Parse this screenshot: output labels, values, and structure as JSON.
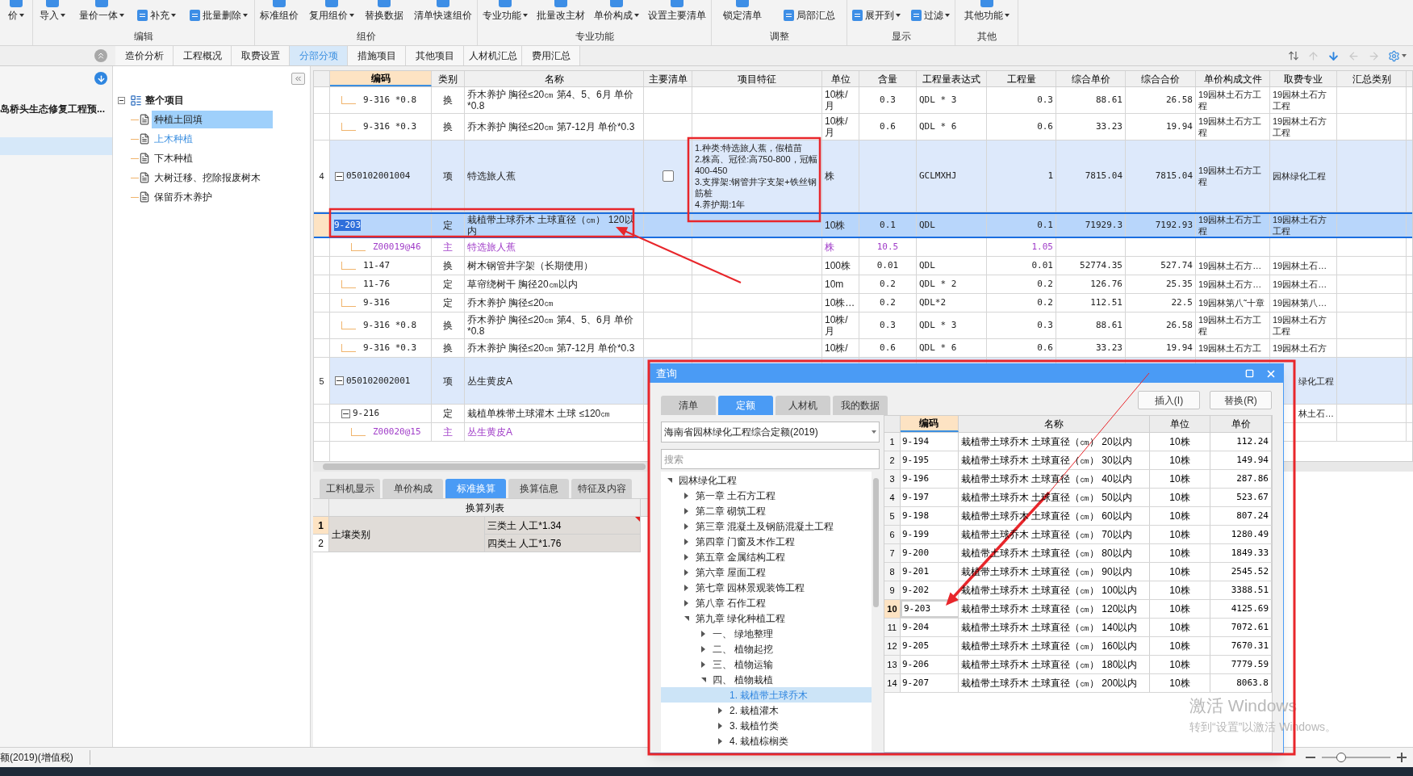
{
  "toolbar": {
    "groups": [
      {
        "tools": [
          {
            "label": "价",
            "menu": true
          }
        ]
      },
      {
        "label": "编辑",
        "tools": [
          {
            "label": "导入",
            "menu": true
          },
          {
            "label": "量价一体",
            "menu": true
          },
          {
            "label": "补充",
            "menu": true
          },
          {
            "label": "批量删除",
            "menu": true
          }
        ]
      },
      {
        "label": "组价",
        "tools": [
          {
            "label": "标准组价",
            "menu": false
          },
          {
            "label": "复用组价",
            "menu": true
          },
          {
            "label": "替换数据",
            "menu": false
          },
          {
            "label": "清单快速组价",
            "menu": false
          }
        ]
      },
      {
        "label": "专业功能",
        "tools": [
          {
            "label": "专业功能",
            "menu": true
          },
          {
            "label": "批量改主材",
            "menu": false
          },
          {
            "label": "单价构成",
            "menu": true
          },
          {
            "label": "设置主要清单",
            "menu": false
          }
        ]
      },
      {
        "label": "调整",
        "tools": [
          {
            "label": "锁定清单",
            "menu": false
          },
          {
            "label": "局部汇总",
            "menu": false
          }
        ]
      },
      {
        "label": "显示",
        "tools": [
          {
            "label": "展开到",
            "menu": true
          },
          {
            "label": "过滤",
            "menu": true
          }
        ]
      },
      {
        "label": "其他",
        "tools": [
          {
            "label": "其他功能",
            "menu": true
          }
        ]
      }
    ]
  },
  "tabs": [
    {
      "label": "造价分析",
      "selected": false
    },
    {
      "label": "工程概况",
      "selected": false
    },
    {
      "label": "取费设置",
      "selected": false
    },
    {
      "label": "分部分项",
      "selected": true
    },
    {
      "label": "措施项目",
      "selected": false
    },
    {
      "label": "其他项目",
      "selected": false
    },
    {
      "label": "人材机汇总",
      "selected": false
    },
    {
      "label": "费用汇总",
      "selected": false
    }
  ],
  "project_panel": {
    "title": "岛桥头生态修复工程预..."
  },
  "section_tree": {
    "label": "整个项目",
    "expanded": true,
    "children": [
      {
        "label": "种植土回填",
        "selected": true,
        "hovered": false
      },
      {
        "label": "上木种植",
        "selected": false,
        "hovered": true
      },
      {
        "label": "下木种植",
        "selected": false,
        "hovered": false
      },
      {
        "label": "大树迁移、挖除报废树木",
        "selected": false,
        "hovered": false
      },
      {
        "label": "保留乔木养护",
        "selected": false,
        "hovered": false
      }
    ]
  },
  "grid": {
    "columns": [
      {
        "label": "编码",
        "selected": true
      },
      {
        "label": "类别",
        "selected": false
      },
      {
        "label": "名称",
        "selected": false
      },
      {
        "label": "主要清单",
        "selected": false
      },
      {
        "label": "项目特征",
        "selected": false
      },
      {
        "label": "单位",
        "selected": false
      },
      {
        "label": "含量",
        "selected": false
      },
      {
        "label": "工程量表达式",
        "selected": false
      },
      {
        "label": "工程量",
        "selected": false
      },
      {
        "label": "综合单价",
        "selected": false
      },
      {
        "label": "综合合价",
        "selected": false
      },
      {
        "label": "单价构成文件",
        "selected": false
      },
      {
        "label": "取费专业",
        "selected": false
      },
      {
        "label": "汇总类别",
        "selected": false
      }
    ],
    "rows": [
      {
        "kind": "quota",
        "selected": false,
        "code": "9-316 *0.8",
        "type": "换",
        "name": "乔木养护 胸径≤20㎝ 第4、5、6月 单价*0.8",
        "unit": "10株/月",
        "ratio": "0.3",
        "expr": "QDL * 3",
        "qty": "0.3",
        "unit_price": "88.61",
        "total": "26.58",
        "price_file": "19园林土石方工程",
        "fee": "19园林土石方工程"
      },
      {
        "kind": "quota",
        "selected": false,
        "code": "9-316 *0.3",
        "type": "换",
        "name": "乔木养护 胸径≤20㎝ 第7-12月 单价*0.3",
        "unit": "10株/月",
        "ratio": "0.6",
        "expr": "QDL * 6",
        "qty": "0.6",
        "unit_price": "33.23",
        "total": "19.94",
        "price_file": "19园林土石方工程",
        "fee": "19园林土石方工程"
      },
      {
        "kind": "item",
        "selected": false,
        "num": "4",
        "code": "050102001004",
        "expanded": true,
        "type": "项",
        "name": "特选旅人蕉",
        "main_list": false,
        "feature": "1.种类:特选旅人蕉，假植苗\n2.株高、冠径:高750-800，冠幅400-450\n3.支撑架:钢管井字支架+铁丝钢筋桩\n4.养护期:1年",
        "unit": "株",
        "expr": "GCLMXHJ",
        "qty": "1",
        "unit_price": "7815.04",
        "total": "7815.04",
        "price_file": "19园林土石方工程",
        "fee": "园林绿化工程"
      },
      {
        "kind": "quota",
        "selected": true,
        "code": "9-203",
        "type": "定",
        "name": "栽植带土球乔木 土球直径（㎝） 120以内",
        "unit": "10株",
        "ratio": "0.1",
        "expr": "QDL",
        "qty": "0.1",
        "unit_price": "71929.3",
        "total": "7192.93",
        "price_file": "19园林土石方工程",
        "fee": "19园林土石方工程"
      },
      {
        "kind": "material",
        "selected": false,
        "code": "Z00019@46",
        "type": "主",
        "name": "特选旅人蕉",
        "unit": "株",
        "ratio": "10.5",
        "qty": "1.05"
      },
      {
        "kind": "quota",
        "selected": false,
        "code": "11-47",
        "type": "换",
        "name": "树木钢管井字架（长期使用）",
        "unit": "100株",
        "ratio": "0.01",
        "expr": "QDL",
        "qty": "0.01",
        "unit_price": "52774.35",
        "total": "527.74",
        "price_file": "19园林土石方…",
        "fee": "19园林土石…"
      },
      {
        "kind": "quota",
        "selected": false,
        "code": "11-76",
        "type": "定",
        "name": "草帘绕树干 胸径20㎝以内",
        "unit": "10m",
        "ratio": "0.2",
        "expr": "QDL * 2",
        "qty": "0.2",
        "unit_price": "126.76",
        "total": "25.35",
        "price_file": "19园林土石方…",
        "fee": "19园林土石…"
      },
      {
        "kind": "quota",
        "selected": false,
        "code": "9-316",
        "type": "定",
        "name": "乔木养护 胸径≤20㎝",
        "unit": "10株…",
        "ratio": "0.2",
        "expr": "QDL*2",
        "qty": "0.2",
        "unit_price": "112.51",
        "total": "22.5",
        "price_file": "19园林第八˜十章",
        "fee": "19园林第八…"
      },
      {
        "kind": "quota",
        "selected": false,
        "code": "9-316 *0.8",
        "type": "换",
        "name": "乔木养护 胸径≤20㎝ 第4、5、6月 单价*0.8",
        "unit": "10株/月",
        "ratio": "0.3",
        "expr": "QDL * 3",
        "qty": "0.3",
        "unit_price": "88.61",
        "total": "26.58",
        "price_file": "19园林土石方工程",
        "fee": "19园林土石方工程"
      },
      {
        "kind": "quota",
        "selected": false,
        "code": "9-316 *0.3",
        "type": "换",
        "name": "乔木养护 胸径≤20㎝ 第7-12月 单价*0.3",
        "unit": "10株/",
        "ratio": "0.6",
        "expr": "QDL * 6",
        "qty": "0.6",
        "unit_price": "33.23",
        "total": "19.94",
        "price_file": "19园林土石方工",
        "fee": "19园林土石方"
      },
      {
        "kind": "item",
        "selected": false,
        "num": "5",
        "code": "050102002001",
        "expanded": true,
        "type": "项",
        "name": "丛生黄皮A",
        "fee": "绿化工程"
      },
      {
        "kind": "quota",
        "selected": false,
        "code": "9-216",
        "expanded": true,
        "type": "定",
        "name": "栽植单株带土球灌木 土球 ≤120㎝",
        "fee": "林土石…"
      },
      {
        "kind": "material",
        "selected": false,
        "code": "Z00020@15",
        "type": "主",
        "name": "丛生黄皮A"
      }
    ]
  },
  "bottom_tabs": [
    {
      "label": "工料机显示",
      "selected": false
    },
    {
      "label": "单价构成",
      "selected": false
    },
    {
      "label": "标准换算",
      "selected": true
    },
    {
      "label": "换算信息",
      "selected": false
    },
    {
      "label": "特征及内容",
      "selected": false
    }
  ],
  "conversion_table": {
    "header": "换算列表",
    "groups": [
      {
        "label": "土壤类别",
        "rows": [
          {
            "num": "1",
            "value": "三类土 人工*1.34",
            "selected": true
          },
          {
            "num": "2",
            "value": "四类土 人工*1.76",
            "selected": false
          }
        ]
      }
    ]
  },
  "status_bar": {
    "text": "额(2019)(增值税)",
    "zoom": {
      "level": 0.25
    }
  },
  "query_dialog": {
    "title": "查询",
    "tabs": [
      {
        "label": "清单",
        "selected": false
      },
      {
        "label": "定额",
        "selected": true
      },
      {
        "label": "人材机",
        "selected": false
      },
      {
        "label": "我的数据",
        "selected": false
      }
    ],
    "buttons": [
      "插入(I)",
      "替换(R)"
    ],
    "library": "海南省园林绿化工程综合定额(2019)",
    "search": {
      "placeholder": "搜索"
    },
    "tree": [
      {
        "label": "园林绿化工程",
        "expanded": true,
        "selected": false,
        "children": [
          {
            "label": "第一章 土石方工程",
            "expanded": false,
            "selected": false
          },
          {
            "label": "第二章 砌筑工程",
            "expanded": false,
            "selected": false
          },
          {
            "label": "第三章 混凝土及钢筋混凝土工程",
            "expanded": false,
            "selected": false
          },
          {
            "label": "第四章 门窗及木作工程",
            "expanded": false,
            "selected": false
          },
          {
            "label": "第五章 金属结构工程",
            "expanded": false,
            "selected": false
          },
          {
            "label": "第六章 屋面工程",
            "expanded": false,
            "selected": false
          },
          {
            "label": "第七章 园林景观装饰工程",
            "expanded": false,
            "selected": false
          },
          {
            "label": "第八章 石作工程",
            "expanded": false,
            "selected": false
          },
          {
            "label": "第九章 绿化种植工程",
            "expanded": true,
            "selected": false,
            "children": [
              {
                "label": "一、 绿地整理",
                "expanded": false,
                "selected": false
              },
              {
                "label": "二、 植物起挖",
                "expanded": false,
                "selected": false
              },
              {
                "label": "三、 植物运输",
                "expanded": false,
                "selected": false
              },
              {
                "label": "四、 植物栽植",
                "expanded": true,
                "selected": false,
                "children": [
                  {
                    "label": "1. 栽植带土球乔木",
                    "selected": true
                  },
                  {
                    "label": "2. 栽植灌木",
                    "expanded": false,
                    "selected": false
                  },
                  {
                    "label": "3. 栽植竹类",
                    "expanded": false,
                    "selected": false
                  },
                  {
                    "label": "4. 栽植棕榈类",
                    "expanded": false,
                    "selected": false
                  }
                ]
              }
            ]
          }
        ]
      }
    ],
    "table": {
      "columns": [
        {
          "label": "编码",
          "selected": true
        },
        {
          "label": "名称",
          "selected": false
        },
        {
          "label": "单位",
          "selected": false
        },
        {
          "label": "单价",
          "selected": false
        }
      ],
      "rows": [
        {
          "num": "1",
          "code": "9-194",
          "name": "栽植带土球乔木 土球直径（㎝） 20以内",
          "unit": "10株",
          "price": "112.24",
          "selected": false
        },
        {
          "num": "2",
          "code": "9-195",
          "name": "栽植带土球乔木 土球直径（㎝） 30以内",
          "unit": "10株",
          "price": "149.94",
          "selected": false
        },
        {
          "num": "3",
          "code": "9-196",
          "name": "栽植带土球乔木 土球直径（㎝） 40以内",
          "unit": "10株",
          "price": "287.86",
          "selected": false
        },
        {
          "num": "4",
          "code": "9-197",
          "name": "栽植带土球乔木 土球直径（㎝） 50以内",
          "unit": "10株",
          "price": "523.67",
          "selected": false
        },
        {
          "num": "5",
          "code": "9-198",
          "name": "栽植带土球乔木 土球直径（㎝） 60以内",
          "unit": "10株",
          "price": "807.24",
          "selected": false
        },
        {
          "num": "6",
          "code": "9-199",
          "name": "栽植带土球乔木 土球直径（㎝） 70以内",
          "unit": "10株",
          "price": "1280.49",
          "selected": false
        },
        {
          "num": "7",
          "code": "9-200",
          "name": "栽植带土球乔木 土球直径（㎝） 80以内",
          "unit": "10株",
          "price": "1849.33",
          "selected": false
        },
        {
          "num": "8",
          "code": "9-201",
          "name": "栽植带土球乔木 土球直径（㎝） 90以内",
          "unit": "10株",
          "price": "2545.52",
          "selected": false
        },
        {
          "num": "9",
          "code": "9-202",
          "name": "栽植带土球乔木 土球直径（㎝） 100以内",
          "unit": "10株",
          "price": "3388.51",
          "selected": false
        },
        {
          "num": "10",
          "code": "9-203",
          "name": "栽植带土球乔木 土球直径（㎝） 120以内",
          "unit": "10株",
          "price": "4125.69",
          "selected": true
        },
        {
          "num": "11",
          "code": "9-204",
          "name": "栽植带土球乔木 土球直径（㎝） 140以内",
          "unit": "10株",
          "price": "7072.61",
          "selected": false
        },
        {
          "num": "12",
          "code": "9-205",
          "name": "栽植带土球乔木 土球直径（㎝） 160以内",
          "unit": "10株",
          "price": "7670.31",
          "selected": false
        },
        {
          "num": "13",
          "code": "9-206",
          "name": "栽植带土球乔木 土球直径（㎝） 180以内",
          "unit": "10株",
          "price": "7779.59",
          "selected": false
        },
        {
          "num": "14",
          "code": "9-207",
          "name": "栽植带土球乔木 土球直径（㎝） 200以内",
          "unit": "10株",
          "price": "8063.8",
          "selected": false
        }
      ]
    }
  },
  "os_notice": {
    "title": "激活 Windows",
    "text": "转到“设置”以激活 Windows。"
  }
}
